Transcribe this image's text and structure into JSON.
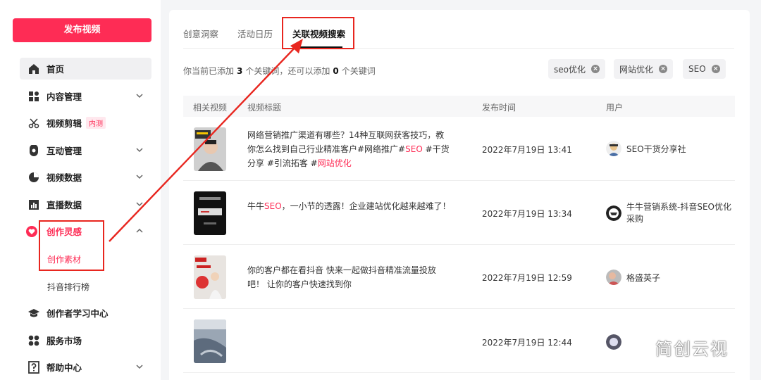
{
  "sidebar": {
    "publish_label": "发布视频",
    "items": [
      {
        "label": "首页",
        "icon": "home-icon"
      },
      {
        "label": "内容管理",
        "icon": "grid-icon"
      },
      {
        "label": "视频剪辑",
        "icon": "scissors-icon",
        "badge": "内测"
      },
      {
        "label": "互动管理",
        "icon": "interaction-icon"
      },
      {
        "label": "视频数据",
        "icon": "pie-chart-icon"
      },
      {
        "label": "直播数据",
        "icon": "bar-chart-icon"
      },
      {
        "label": "创作灵感",
        "icon": "heart-icon"
      },
      {
        "label": "创作者学习中心",
        "icon": "graduation-cap-icon"
      },
      {
        "label": "服务市场",
        "icon": "apps-icon"
      },
      {
        "label": "帮助中心",
        "icon": "help-icon"
      }
    ],
    "sub_items": [
      "创作素材",
      "抖音排行榜"
    ]
  },
  "tabs": [
    "创意洞察",
    "活动日历",
    "关联视频搜索"
  ],
  "keyword_info": {
    "prefix": "你当前已添加",
    "added": "3",
    "middle": "个关键词，还可以添加",
    "remaining": "0",
    "suffix": "个关键词"
  },
  "keywords": [
    "seo优化",
    "网站优化",
    "SEO"
  ],
  "table": {
    "headers": [
      "相关视频",
      "视频标题",
      "发布时间",
      "用户"
    ],
    "rows": [
      {
        "title_parts": [
          {
            "text": "网络营销推广渠道有哪些？14种互联网获客技巧，教你怎么找到自己行业精准客户#网络推广#",
            "tag": false
          },
          {
            "text": "SEO",
            "tag": true
          },
          {
            "text": " #干货分享 #引流拓客 #",
            "tag": false
          },
          {
            "text": "网站优化",
            "tag": true
          }
        ],
        "time": "2022年7月19日 13:41",
        "user": "SEO干货分享社"
      },
      {
        "title_parts": [
          {
            "text": "牛牛",
            "tag": false
          },
          {
            "text": "SEO",
            "tag": true
          },
          {
            "text": "，一小节的透露！企业建站优化越来越难了！",
            "tag": false
          }
        ],
        "time": "2022年7月19日 13:34",
        "user": "牛牛营销系统-抖音SEO优化采购"
      },
      {
        "title_parts": [
          {
            "text": "你的客户都在看抖音 快来一起做抖音精准流量投放吧！ 让你的客户快速找到你",
            "tag": false
          }
        ],
        "time": "2022年7月19日 12:59",
        "user": "格盛英子"
      },
      {
        "title_parts": [],
        "time": "2022年7月19日 12:44",
        "user": ""
      }
    ]
  },
  "watermark": "简创云视",
  "colors": {
    "accent": "#fe2c55",
    "annotation": "#e8261f"
  }
}
